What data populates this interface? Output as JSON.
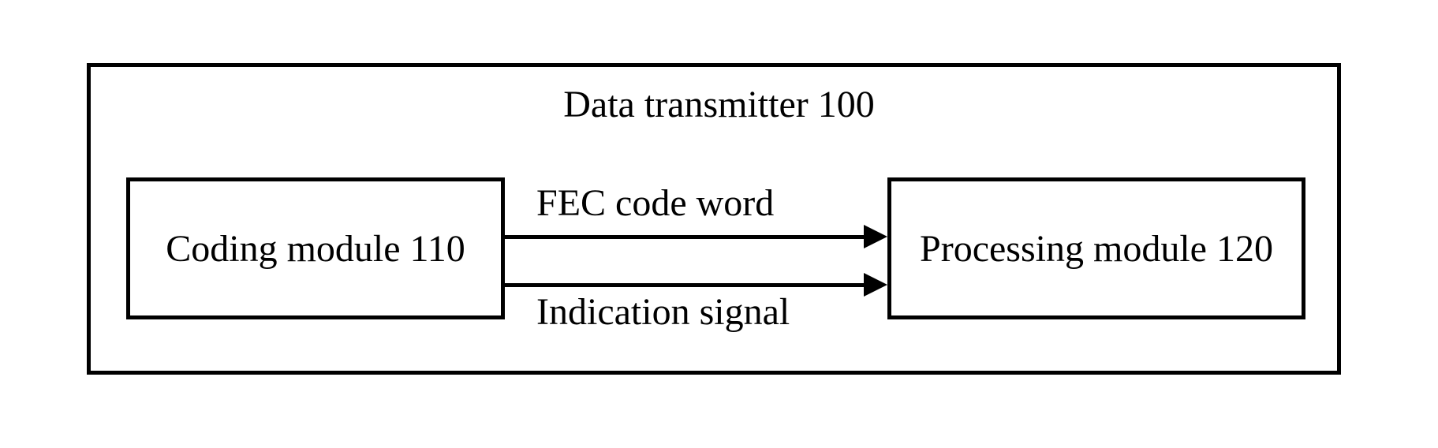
{
  "diagram": {
    "title": "Data transmitter 100",
    "coding_module": "Coding module 110",
    "processing_module": "Processing module 120",
    "arrow_top_label": "FEC code word",
    "arrow_bottom_label": "Indication signal"
  }
}
